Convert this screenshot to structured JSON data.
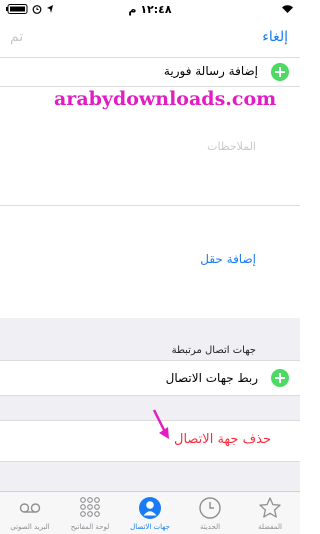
{
  "status_bar": {
    "time": "١٢:٤٨ م"
  },
  "nav": {
    "cancel_label": "إلغاء",
    "done_label": "تم"
  },
  "rows": {
    "instant_message_label": "إضافة رسالة فورية",
    "notes_placeholder": "الملاحظات",
    "add_field_label": "إضافة حقل",
    "linked_contacts_header": "جهات اتصال مرتبطة",
    "link_contacts_label": "ربط جهات الاتصال",
    "delete_contact_label": "حذف جهة الاتصال"
  },
  "watermark": "arabydownloads.com",
  "tabbar": {
    "items": [
      {
        "label": "البريد الصوتي",
        "icon": "voicemail-icon",
        "active": false
      },
      {
        "label": "لوحة المفاتيح",
        "icon": "keypad-icon",
        "active": false
      },
      {
        "label": "جهات الاتصال",
        "icon": "contacts-icon",
        "active": true
      },
      {
        "label": "الحديثة",
        "icon": "clock-icon",
        "active": false
      },
      {
        "label": "المفضلة",
        "icon": "star-icon",
        "active": false
      }
    ]
  },
  "colors": {
    "accent": "#1a7cf4",
    "destructive": "#ff2d3b",
    "add": "#4cd964",
    "watermark": "#e01ec4",
    "arrow": "#e01ec4"
  }
}
